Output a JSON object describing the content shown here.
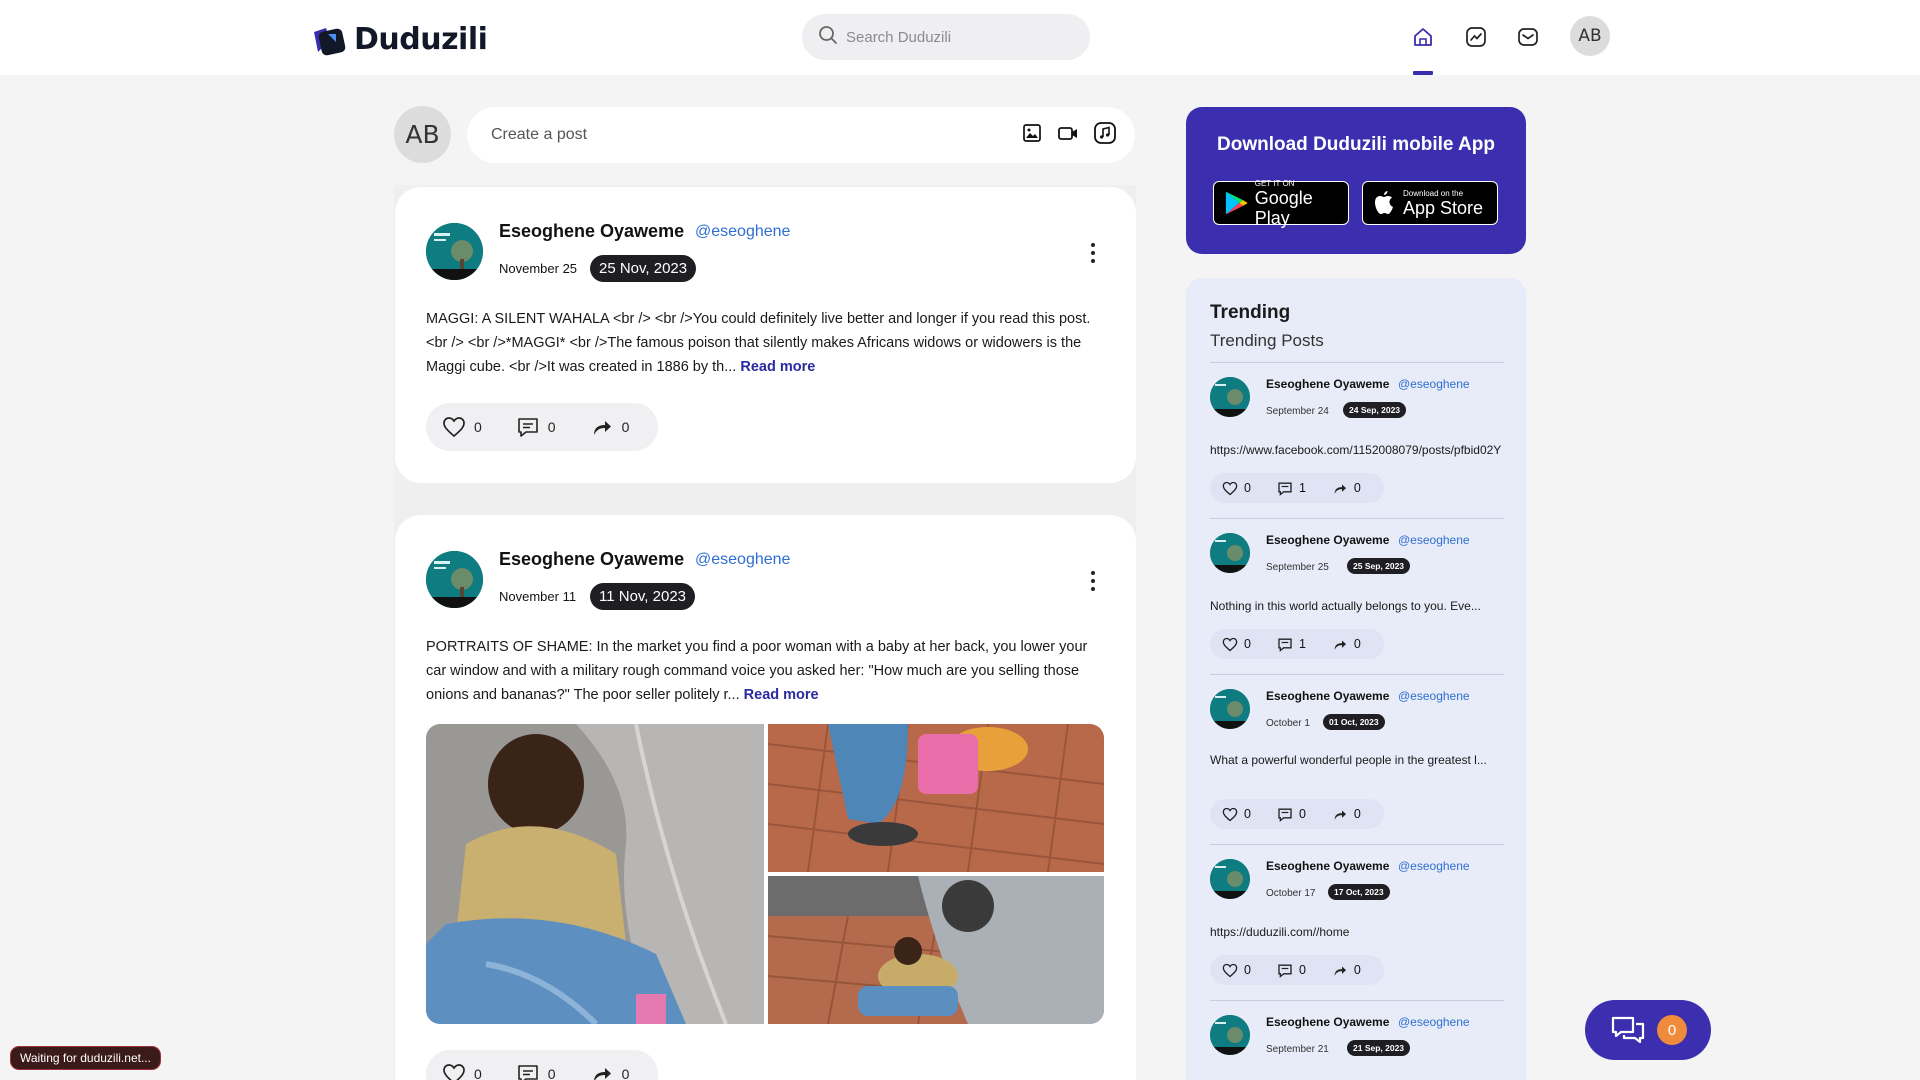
{
  "header": {
    "logo_text": "Duduzili",
    "search_placeholder": "Search Duduzili",
    "avatar_initials": "AB"
  },
  "composer": {
    "avatar_initials": "AB",
    "placeholder": "Create a post"
  },
  "posts": [
    {
      "author": "Eseoghene Oyaweme",
      "handle": "@eseoghene",
      "date": "November 25",
      "badge": "25 Nov, 2023",
      "body": "MAGGI: A SILENT WAHALA <br /> <br />You could definitely live better and longer if you read this post. <br /> <br />*MAGGI* <br />The famous poison that silently makes Africans widows or widowers is the Maggi cube. <br />It was created in 1886 by th...",
      "read_more": "Read more",
      "likes": "0",
      "comments": "0",
      "shares": "0"
    },
    {
      "author": "Eseoghene Oyaweme",
      "handle": "@eseoghene",
      "date": "November 11",
      "badge": "11 Nov, 2023",
      "body": "PORTRAITS OF SHAME: In the market you find a poor woman with a baby at her back, you lower your car window and with a military rough command voice you asked her: \"How much are you selling those onions and bananas?\" The poor seller politely r...",
      "read_more": "Read more",
      "likes": "0",
      "comments": "0",
      "shares": "0"
    }
  ],
  "app_card": {
    "title": "Download Duduzili mobile App",
    "google_small": "GET IT ON",
    "google_big": "Google Play",
    "apple_small": "Download on the",
    "apple_big": "App Store"
  },
  "trending": {
    "title": "Trending",
    "subtitle": "Trending Posts",
    "items": [
      {
        "author": "Eseoghene Oyaweme",
        "handle": "@eseoghene",
        "date": "September 24",
        "badge": "24 Sep, 2023",
        "body": "https://www.facebook.com/1152008079/posts/pfbid02Y",
        "likes": "0",
        "comments": "1",
        "shares": "0"
      },
      {
        "author": "Eseoghene Oyaweme",
        "handle": "@eseoghene",
        "date": "September 25",
        "badge": "25 Sep, 2023",
        "body": "Nothing in this world actually belongs to you. Eve...",
        "likes": "0",
        "comments": "1",
        "shares": "0"
      },
      {
        "author": "Eseoghene Oyaweme",
        "handle": "@eseoghene",
        "date": "October 1",
        "badge": "01 Oct, 2023",
        "body": "What a powerful wonderful people in the greatest l...",
        "likes": "0",
        "comments": "0",
        "shares": "0"
      },
      {
        "author": "Eseoghene Oyaweme",
        "handle": "@eseoghene",
        "date": "October 17",
        "badge": "17 Oct, 2023",
        "body": "https://duduzili.com//home",
        "likes": "0",
        "comments": "0",
        "shares": "0"
      },
      {
        "author": "Eseoghene Oyaweme",
        "handle": "@eseoghene",
        "date": "September 21",
        "badge": "21 Sep, 2023"
      }
    ]
  },
  "chat": {
    "count": "0"
  },
  "status": {
    "text": "Waiting for duduzili.net..."
  },
  "colors": {
    "accent": "#3b2fb0",
    "link": "#2e6fd1",
    "badge": "#1f1f23",
    "chat_badge": "#f08a3c"
  }
}
